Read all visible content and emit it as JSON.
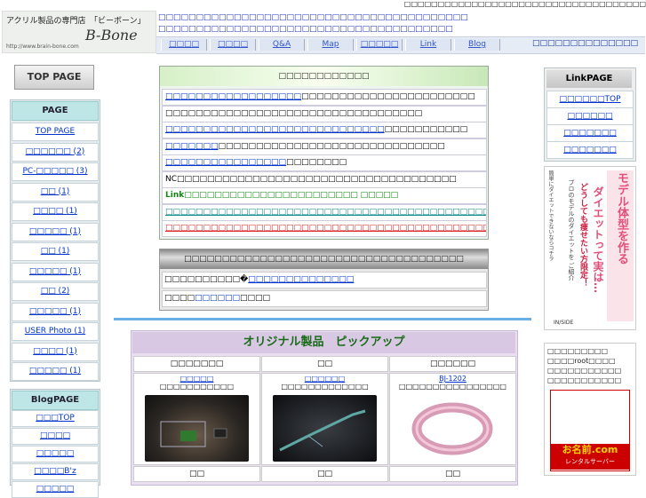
{
  "top_strip": "□□□□□□□□□□□□□□□□□□□□□□□□□□□□□□□□□□□□",
  "logo": {
    "caption": "アクリル製品の専門店　「ビーボーン」",
    "brand": "B-Bone",
    "url": "http://www.brain-bone.com"
  },
  "header": {
    "line1": "□□□□□□□□□□□□□□□□□□□□□□□□□□□□□□□□□□□□□□□□□",
    "line2": "□□□□□□□□□□□□□□□□□□□□□□□□□□□□□□□□□□□□□□□"
  },
  "nav": {
    "items": [
      "□□□□",
      "□□□□",
      "Q&A",
      "Map",
      "□□□□□",
      "Link",
      "Blog"
    ],
    "right_text": "□□□□□□□□□□□□□□"
  },
  "left": {
    "top_page_button": "TOP PAGE",
    "page_header": "PAGE",
    "page_items": [
      "TOP PAGE",
      "□□□□□□ (2)",
      "PC-□□□□□ (3)",
      "□□ (1)",
      "□□□□ (1)",
      "□□□□□ (1)",
      "□□ (1)",
      "□□□□□ (1)",
      "□□ (2)",
      "□□□□□ (1)",
      "USER Photo (1)",
      "□□□□ (1)",
      "□□□□□ (1)"
    ],
    "blog_header": "BlogPAGE",
    "blog_items": [
      "□□□TOP",
      "□□□□",
      "□□□□□",
      "□□□□B'z",
      "□□□□□"
    ]
  },
  "info": {
    "header": "□□□□□□□□□□□□",
    "rows": [
      {
        "link": "□□□□□□□□□□□□□□□□□□",
        "rest": "□□□□□□□□□□□□□□□□□□□□□□□",
        "color": "#0033cc"
      },
      {
        "link": "",
        "rest": "□□□□□□□□□□□□□□□□□□□□□□□□□□□□□□□□□□",
        "color": "#000000"
      },
      {
        "link": "□□□□□□□□□□□□□□□□□□□□□□□□□□□□□",
        "rest": "□□□□□□□□□□□",
        "color": "#0033cc"
      },
      {
        "link": "□□□□□□□",
        "rest": "□□□□□□□□□□□□□□□□□□□□□□□□□□□□□□",
        "color": "#0033cc"
      },
      {
        "link": "□□□□□□□□□□□□□□□□",
        "rest": "□□□□□□□□",
        "color": "#0033cc"
      },
      {
        "link": "",
        "rest": "NC□□□□□□□□□□□□□□□□□□□□□□□□□□□□□□□□□□□□□",
        "color": "#000000"
      },
      {
        "link": "Link",
        "rest": "□□□□□□□□□□□□□□□□□□□□□□□ □□□□□",
        "color": "#118811"
      },
      {
        "link": "□□□□□□□□□□□□□□□□□□□□□□□□□□□□□□□□□□□□□□□□□□□□□",
        "rest": "",
        "color": "#118888"
      },
      {
        "link": "□□□□□□□□□□□□□□□□□□□□□□□□□□□□□□□□□□□□□□□□□□□□",
        "rest": "",
        "color": "#dd2222"
      }
    ]
  },
  "box2": {
    "header": "□□□□□□□□□□□□□□□□□□□□□□□□□□□□□□□□□□□□□",
    "row1_prefix": "□□□□□□□□□□�",
    "row1_link": "□□□□□□□□□□□□□□",
    "row2_prefix": "□□□□",
    "row2_link": "□□□□□□",
    "row2_suffix": "□□□□"
  },
  "products": {
    "title": "オリジナル製品　ピックアップ",
    "items": [
      {
        "category": "□□□□□□□",
        "name": "□□□□□",
        "sub": "□□□□□□□□□□□",
        "label": "□□"
      },
      {
        "category": "□□",
        "name": "□□□□□□",
        "sub": "□□□□□□□□□□□□□",
        "label": "□□"
      },
      {
        "category": "□□□□□□",
        "name": "BJ-1202",
        "sub": "□□□□□□□□□□□□□□□□",
        "label": "□□"
      }
    ]
  },
  "right": {
    "link_header": "LinkPAGE",
    "link_items": [
      "□□□□□□TOP",
      "□□□□□□",
      "□□□□□□□",
      "□□□□□□□"
    ],
    "ad_big": "モデル体型を作る",
    "ad_mid": "ダイエットって実は…",
    "ad_red": "どうしても痩せたい方限定！",
    "ad_small": "プロのモデルのダイエットを ご紹介",
    "ad_note": "簡単にダイエットできないならコチラ",
    "ad_brand": "IN/SIDE",
    "server_text": "□□□□□□□□□ □□□□root□□□□ □□□□□□□□□□□ □□□□□□□□□□□",
    "onamae_brand": "お名前.com",
    "onamae_sub": "レンタルサーバー"
  }
}
